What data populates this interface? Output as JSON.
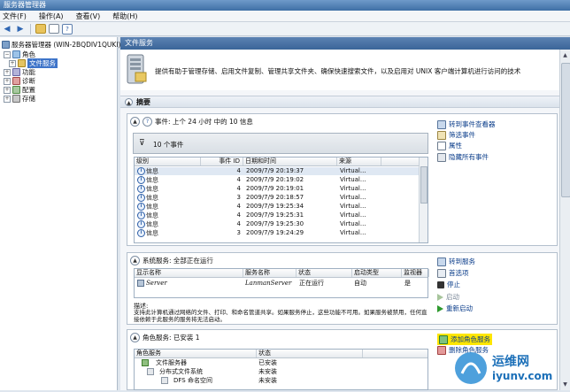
{
  "window": {
    "title": "服务器管理器"
  },
  "menu": {
    "items": [
      "文件(F)",
      "操作(A)",
      "查看(V)",
      "帮助(H)"
    ]
  },
  "tree": {
    "root": "服务器管理器 (WIN-2BQDIV1QUKI)",
    "items": [
      {
        "label": "角色",
        "expanded": true
      },
      {
        "label": "文件服务",
        "selected": true
      },
      {
        "label": "功能"
      },
      {
        "label": "诊断"
      },
      {
        "label": "配置"
      },
      {
        "label": "存储"
      }
    ]
  },
  "header": {
    "title": "文件服务"
  },
  "description": "提供有助于管理存储、启用文件复制、管理共享文件夹、确保快速搜索文件，以及启用对 UNIX 客户端计算机进行访问的技术",
  "summary": {
    "label": "摘要"
  },
  "events": {
    "label": "事件: 上个 24 小时 中的 10 信息",
    "filter_label": "10 个事件",
    "columns": [
      "级别",
      "事件 ID",
      "日期和时间",
      "来源"
    ],
    "rows": [
      {
        "level": "信息",
        "id": "4",
        "datetime": "2009/7/9 20:19:37",
        "source": "Virtual..."
      },
      {
        "level": "信息",
        "id": "4",
        "datetime": "2009/7/9 20:19:02",
        "source": "Virtual..."
      },
      {
        "level": "信息",
        "id": "4",
        "datetime": "2009/7/9 20:19:01",
        "source": "Virtual..."
      },
      {
        "level": "信息",
        "id": "3",
        "datetime": "2009/7/9 20:18:57",
        "source": "Virtual..."
      },
      {
        "level": "信息",
        "id": "4",
        "datetime": "2009/7/9 19:25:34",
        "source": "Virtual..."
      },
      {
        "level": "信息",
        "id": "4",
        "datetime": "2009/7/9 19:25:31",
        "source": "Virtual..."
      },
      {
        "level": "信息",
        "id": "4",
        "datetime": "2009/7/9 19:25:30",
        "source": "Virtual..."
      },
      {
        "level": "信息",
        "id": "3",
        "datetime": "2009/7/9 19:24:29",
        "source": "Virtual..."
      }
    ],
    "tasks": [
      "转到事件查看器",
      "筛选事件",
      "属性",
      "隐藏所有事件"
    ]
  },
  "services": {
    "label": "系统服务: 全部正在运行",
    "columns": [
      "显示名称",
      "服务名称",
      "状态",
      "启动类型",
      "监视器"
    ],
    "rows": [
      {
        "display": "Server",
        "name": "LanmanServer",
        "status": "正在运行",
        "startup": "自动",
        "monitor": "是"
      }
    ],
    "desc_label": "描述:",
    "desc_text": "支持此计算机通过网络的文件、打印、和命名管道共享。如果服务停止，这些功能不可用。如果服务被禁用，任何直接依赖于此服务的服务将无法启动。",
    "tasks": [
      "转到服务",
      "首选项",
      "停止",
      "启动",
      "重新启动"
    ]
  },
  "role_services": {
    "label": "角色服务: 已安装 1",
    "columns": [
      "角色服务",
      "状态"
    ],
    "rows": [
      {
        "name": "文件服务器",
        "status": "已安装"
      },
      {
        "name": "分布式文件系统",
        "status": "未安装"
      },
      {
        "name": "DFS 命名空间",
        "status": "未安装"
      }
    ],
    "tasks": [
      "添加角色服务",
      "删除角色服务"
    ]
  },
  "watermark": {
    "brand": "运维网",
    "site": "iyunv.com"
  },
  "colors": {
    "accent": "#3e74c9",
    "header": "#3b6598",
    "highlight": "#ffe600"
  }
}
